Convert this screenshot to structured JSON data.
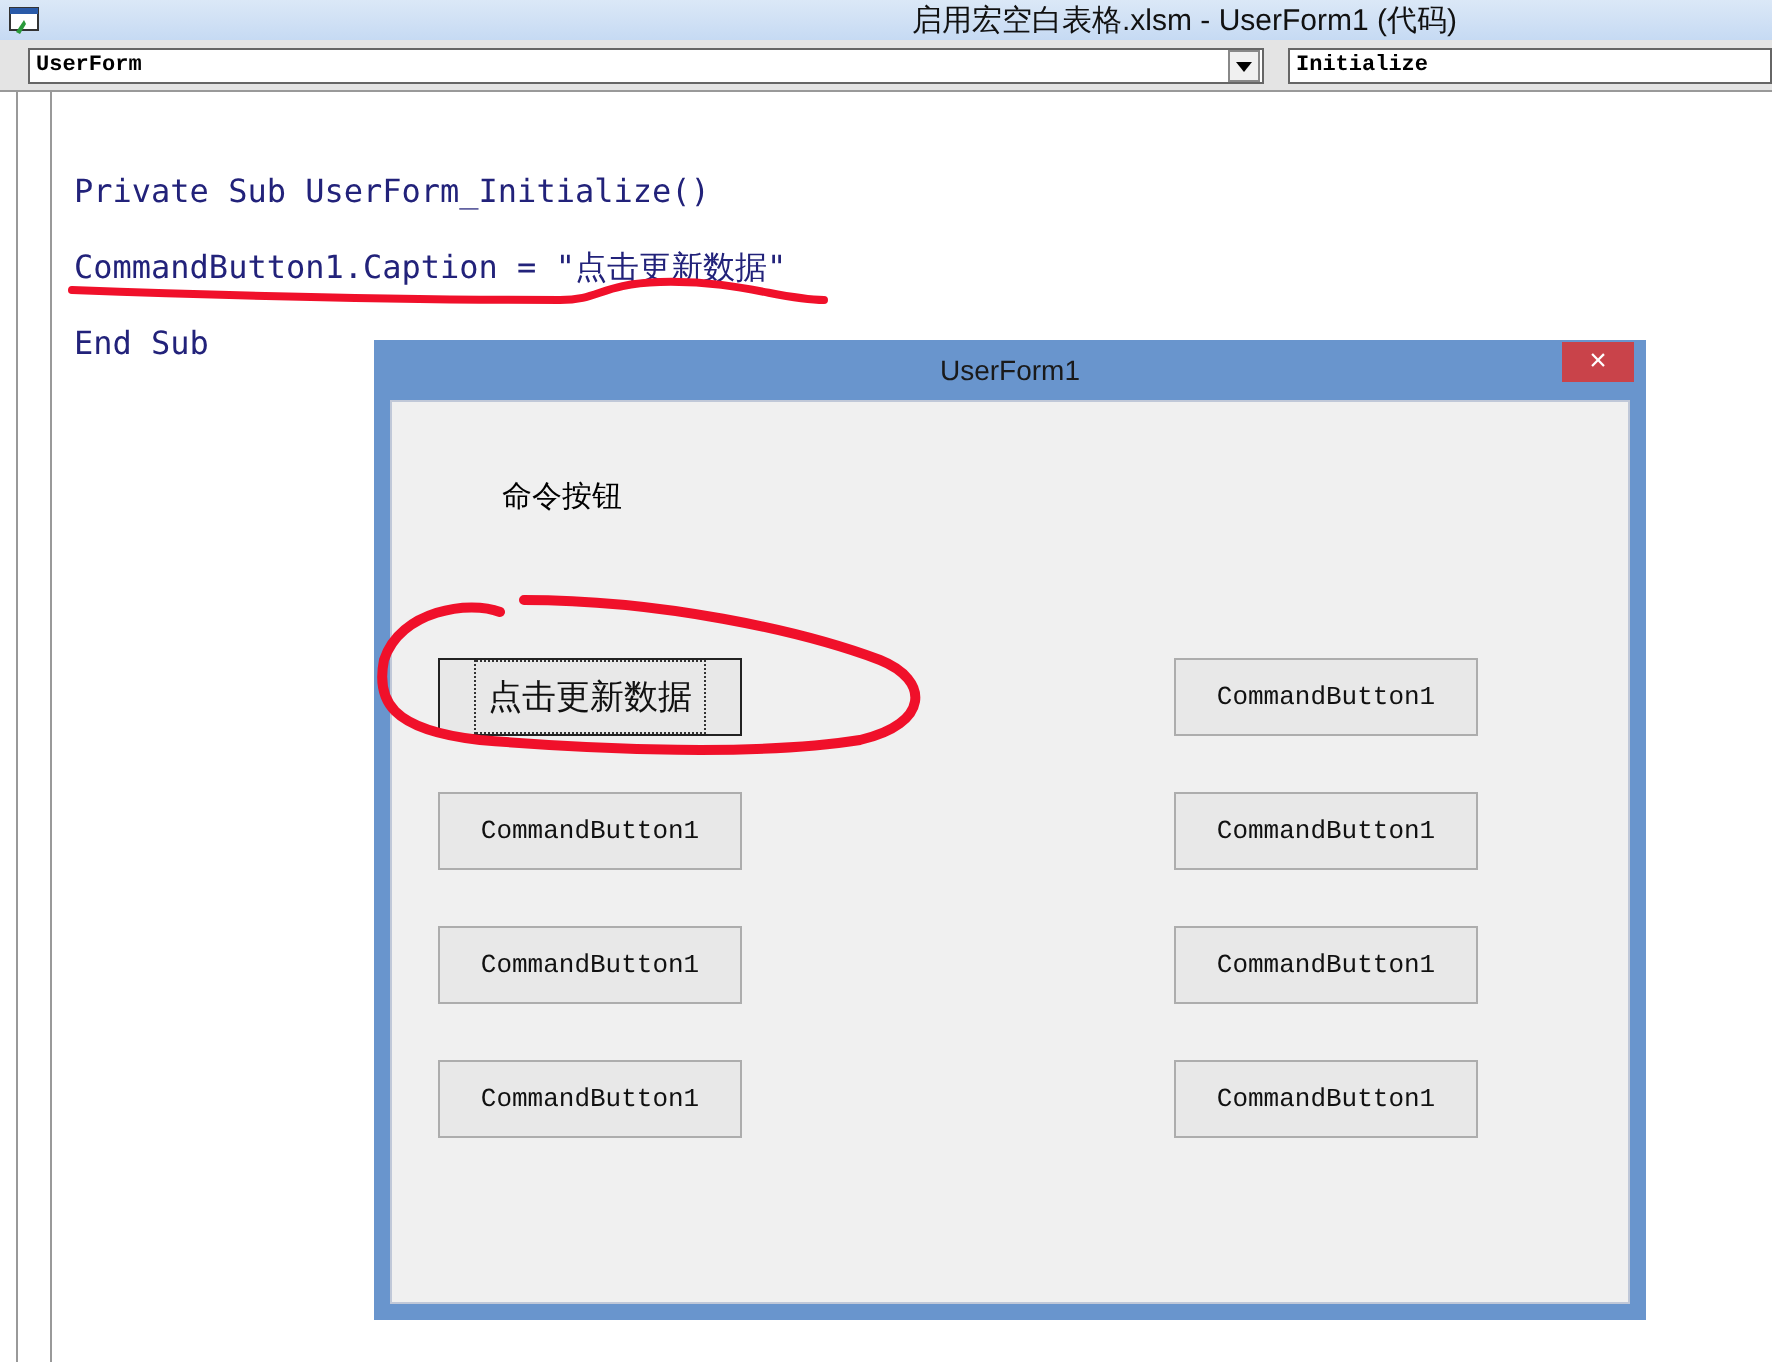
{
  "window": {
    "title": "启用宏空白表格.xlsm - UserForm1 (代码)"
  },
  "object_combo": {
    "value": "UserForm"
  },
  "procedure_combo": {
    "value": "Initialize"
  },
  "code_lines": [
    "Private Sub UserForm_Initialize()",
    "CommandButton1.Caption = \"点击更新数据\"",
    "End Sub"
  ],
  "userform": {
    "title": "UserForm1",
    "close": "×",
    "label": "命令按钮",
    "buttons": [
      {
        "label": "点击更新数据",
        "focused": true
      },
      {
        "label": "CommandButton1",
        "focused": false
      },
      {
        "label": "CommandButton1",
        "focused": false
      },
      {
        "label": "CommandButton1",
        "focused": false
      },
      {
        "label": "CommandButton1",
        "focused": false
      },
      {
        "label": "CommandButton1",
        "focused": false
      },
      {
        "label": "CommandButton1",
        "focused": false
      },
      {
        "label": "CommandButton1",
        "focused": false
      }
    ]
  }
}
